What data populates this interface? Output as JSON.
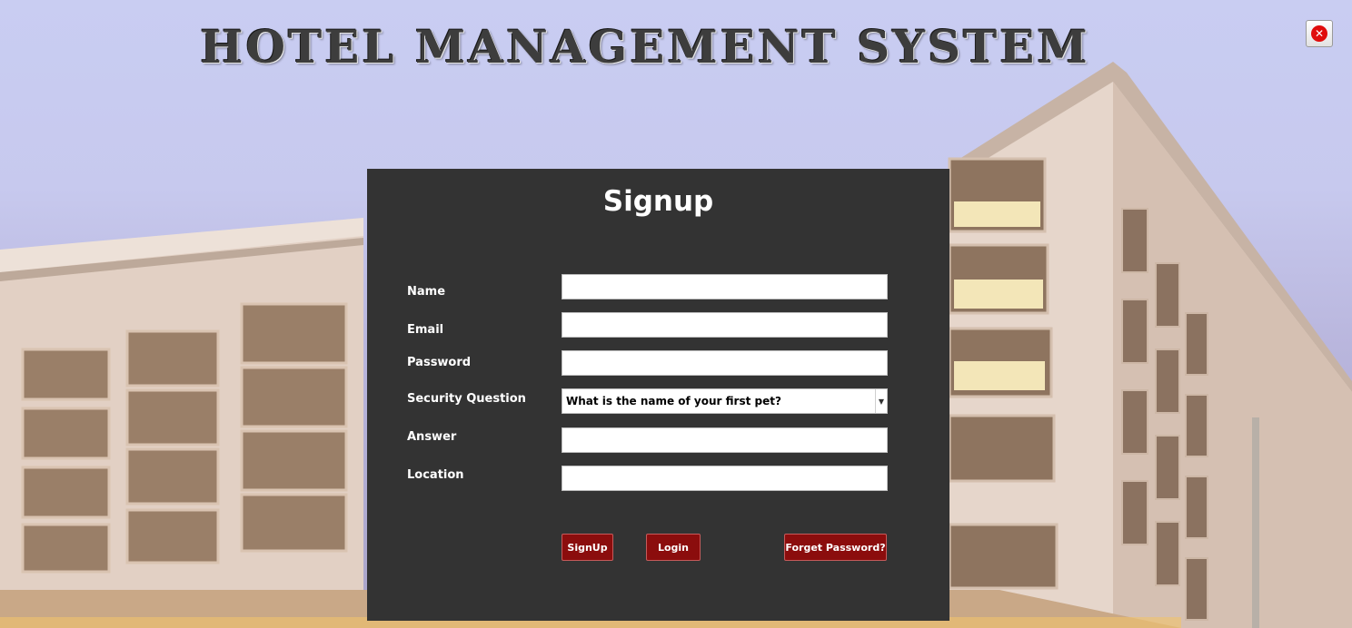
{
  "header": {
    "title": "HOTEL MANAGEMENT SYSTEM",
    "close_icon": "close-icon"
  },
  "form": {
    "title": "Signup",
    "fields": {
      "name": {
        "label": "Name",
        "value": ""
      },
      "email": {
        "label": "Email",
        "value": ""
      },
      "password": {
        "label": "Password",
        "value": ""
      },
      "security_question": {
        "label": "Security Question",
        "value": "What is the name of your first pet?"
      },
      "answer": {
        "label": "Answer",
        "value": ""
      },
      "location": {
        "label": "Location",
        "value": ""
      }
    },
    "buttons": {
      "signup": "SignUp",
      "login": "Login",
      "forget_password": "Forget Password?"
    }
  },
  "colors": {
    "panel": "#333333",
    "button": "#8b0d0d",
    "close": "#e00c0c"
  }
}
